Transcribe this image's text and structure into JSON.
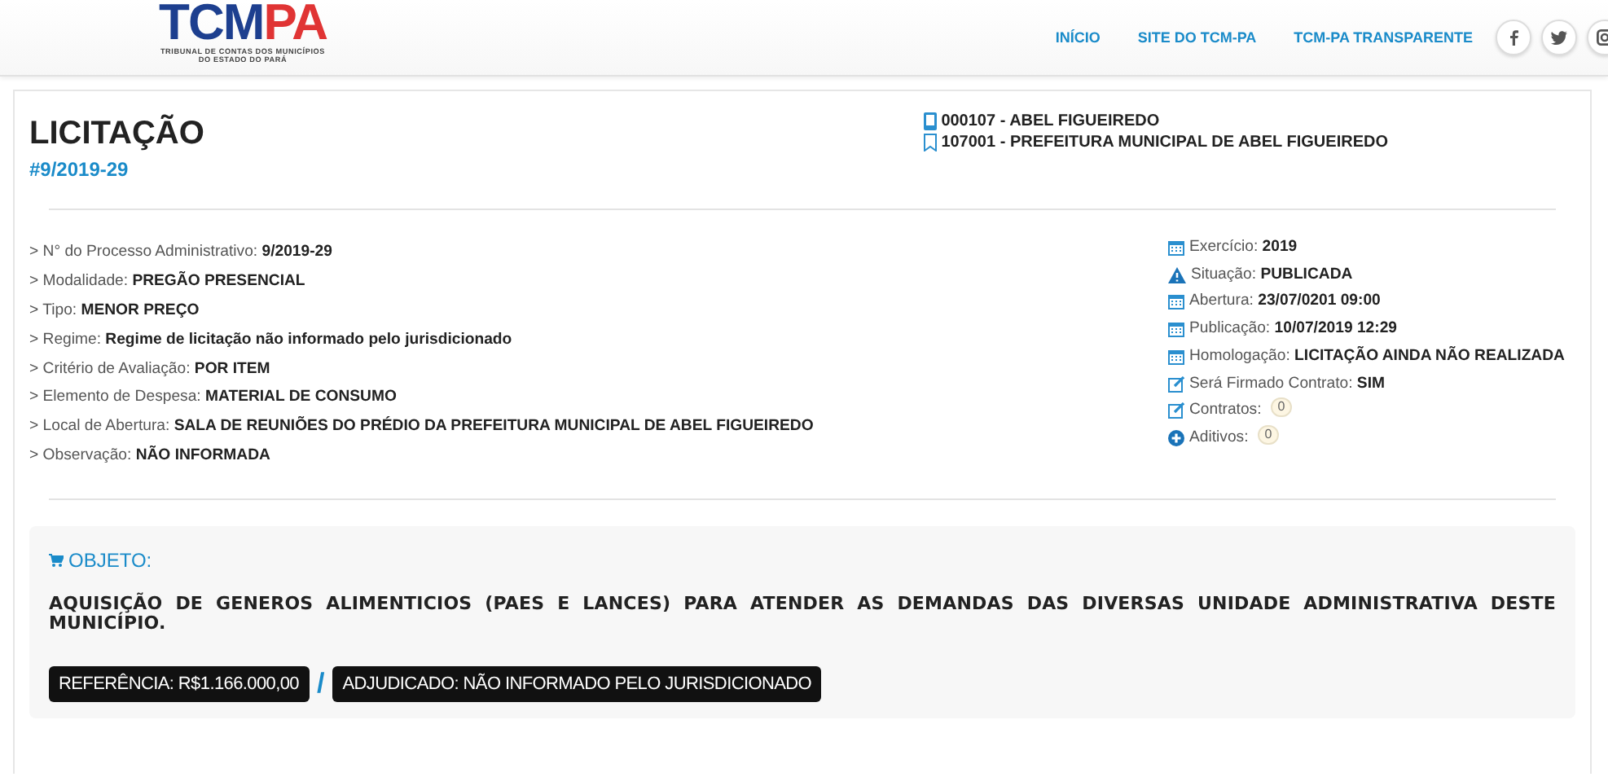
{
  "logo": {
    "main": "TCM",
    "accent": "PA",
    "subtitle_lines": [
      "TRIBUNAL DE CONTAS DOS MUNICÍPIOS",
      "DO ESTADO DO PARÁ"
    ]
  },
  "nav": [
    {
      "label": "INÍCIO"
    },
    {
      "label": "SITE DO TCM-PA"
    },
    {
      "label": "TCM-PA TRANSPARENTE"
    }
  ],
  "social": [
    {
      "kind": "letter-f"
    },
    {
      "kind": "bird"
    },
    {
      "kind": "camera"
    }
  ],
  "header": {
    "title": "LICITAÇÃO",
    "number": "#9/2019-29",
    "entities": [
      {
        "kind": "phone",
        "text": "000107 - ABEL FIGUEIREDO"
      },
      {
        "kind": "bookmark",
        "text": "107001 - PREFEITURA MUNICIPAL DE ABEL FIGUEIREDO"
      }
    ]
  },
  "details": [
    {
      "marker": ">",
      "label": "N° do Processo Administrativo:",
      "value": "9/2019-29"
    },
    {
      "marker": ">",
      "label": "Modalidade:",
      "value": "PREGÃO PRESENCIAL"
    },
    {
      "marker": ">",
      "label": "Tipo:",
      "value": "MENOR PREÇO"
    },
    {
      "marker": ">",
      "label": "Regime:",
      "value": "Regime de licitação não informado pelo jurisdicionado"
    },
    {
      "marker": ">",
      "label": "Critério de Avaliação:",
      "value": "POR ITEM"
    },
    {
      "marker": ">",
      "label": "Elemento de Despesa:",
      "value": "MATERIAL DE CONSUMO"
    },
    {
      "marker": ">",
      "label": "Local de Abertura:",
      "value": "SALA DE REUNIÕES DO PRÉDIO DA PREFEITURA MUNICIPAL DE ABEL FIGUEIREDO"
    },
    {
      "marker": ">",
      "label": "Observação:",
      "value": "NÃO INFORMADA"
    }
  ],
  "status": [
    {
      "kind": "calendar",
      "label": "Exercício:",
      "value": "2019"
    },
    {
      "kind": "warning",
      "label": "Situação:",
      "value": "PUBLICADA"
    },
    {
      "kind": "calendar",
      "label": "Abertura:",
      "value": "23/07/0201 09:00"
    },
    {
      "kind": "calendar",
      "label": "Publicação:",
      "value": "10/07/2019 12:29"
    },
    {
      "kind": "calendar",
      "label": "Homologação:",
      "value": "LICITAÇÃO AINDA NÃO REALIZADA"
    },
    {
      "kind": "edit",
      "label": "Será Firmado Contrato:",
      "value": "SIM"
    },
    {
      "kind": "edit",
      "label": "Contratos:",
      "badge": "0"
    },
    {
      "kind": "plus",
      "label": "Aditivos:",
      "badge": "0"
    }
  ],
  "objeto": {
    "heading": "OBJETO:",
    "description": "AQUISIÇÃO DE GENEROS ALIMENTICIOS (PAES E LANCES) PARA ATENDER AS DEMANDAS DAS DIVERSAS UNIDADE ADMINISTRATIVA DESTE MUNICÍPIO.",
    "tags": [
      {
        "text": "REFERÊNCIA: R$1.166.000,00"
      },
      {
        "text": "ADJUDICADO: NÃO INFORMADO PELO JURISDICIONADO"
      }
    ],
    "separator": "/"
  }
}
